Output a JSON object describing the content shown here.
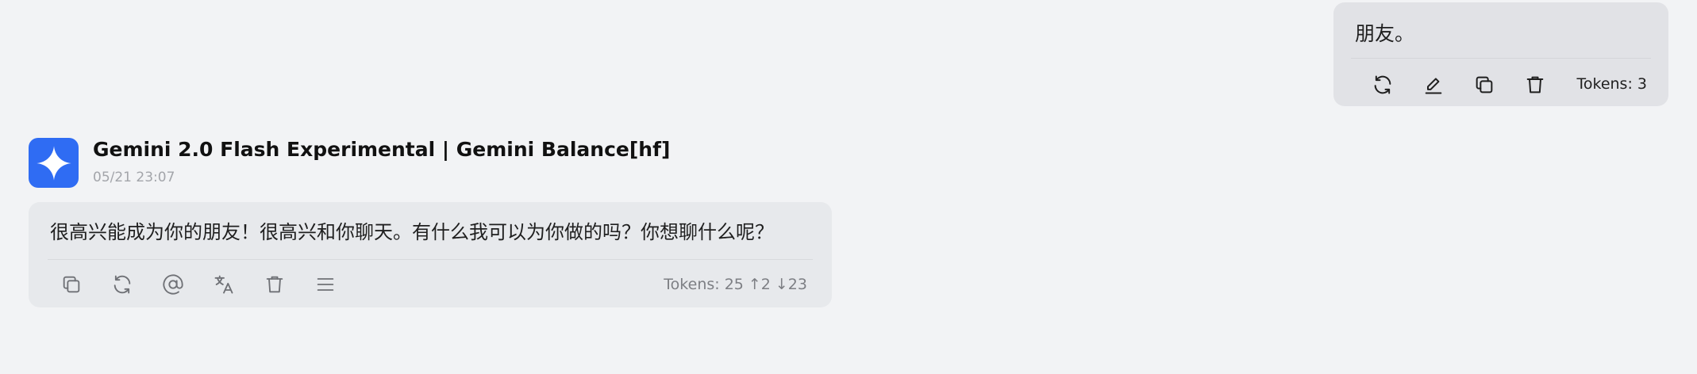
{
  "user_message": {
    "text": "朋友。",
    "tokens_label": "Tokens: 3",
    "actions": [
      {
        "name": "regenerate",
        "icon": "refresh-icon"
      },
      {
        "name": "edit",
        "icon": "pencil-icon"
      },
      {
        "name": "copy",
        "icon": "copy-icon"
      },
      {
        "name": "delete",
        "icon": "trash-icon"
      }
    ]
  },
  "assistant_message": {
    "model": "Gemini 2.0 Flash Experimental | Gemini Balance[hf]",
    "timestamp": "05/21 23:07",
    "text": "很高兴能成为你的朋友！很高兴和你聊天。有什么我可以为你做的吗？你想聊什么呢？",
    "tokens_label": "Tokens: 25",
    "tokens_up": "↑2",
    "tokens_down": "↓23",
    "actions": [
      {
        "name": "copy",
        "icon": "copy-icon"
      },
      {
        "name": "regenerate",
        "icon": "refresh-icon"
      },
      {
        "name": "mention",
        "icon": "at-icon"
      },
      {
        "name": "translate",
        "icon": "translate-icon"
      },
      {
        "name": "delete",
        "icon": "trash-icon"
      },
      {
        "name": "more",
        "icon": "menu-icon"
      }
    ]
  },
  "colors": {
    "background": "#f2f3f5",
    "user_bubble": "#e1e2e6",
    "assistant_bubble": "#e7e9ec",
    "avatar": "#2f6cf3"
  }
}
